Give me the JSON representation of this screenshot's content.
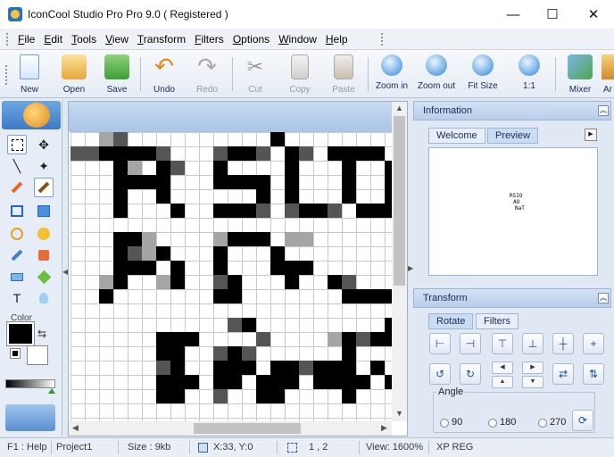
{
  "window": {
    "title": "IconCool Studio Pro Pro 9.0 ( Registered )",
    "minimize_glyph": "—",
    "maximize_glyph": "☐",
    "close_glyph": "✕"
  },
  "menu": [
    "File",
    "Edit",
    "Tools",
    "View",
    "Transform",
    "Filters",
    "Options",
    "Window",
    "Help"
  ],
  "toolbar": [
    {
      "label": "New",
      "icon": "new-file-icon",
      "enabled": true
    },
    {
      "label": "Open",
      "icon": "open-folder-icon",
      "enabled": true
    },
    {
      "label": "Save",
      "icon": "save-disk-icon",
      "enabled": true
    },
    {
      "label": "Undo",
      "icon": "undo-arrow-icon",
      "enabled": true
    },
    {
      "label": "Redo",
      "icon": "redo-arrow-icon",
      "enabled": false
    },
    {
      "label": "Cut",
      "icon": "scissors-icon",
      "enabled": false
    },
    {
      "label": "Copy",
      "icon": "copy-icon",
      "enabled": false
    },
    {
      "label": "Paste",
      "icon": "paste-icon",
      "enabled": false
    },
    {
      "label": "Zoom in",
      "icon": "zoom-in-icon",
      "enabled": true
    },
    {
      "label": "Zoom out",
      "icon": "zoom-out-icon",
      "enabled": true
    },
    {
      "label": "Fit Size",
      "icon": "fit-size-icon",
      "enabled": true
    },
    {
      "label": "1:1",
      "icon": "actual-size-icon",
      "enabled": true
    },
    {
      "label": "Mixer",
      "icon": "mixer-icon",
      "enabled": true
    },
    {
      "label": "Ar",
      "icon": "arrange-icon",
      "enabled": true
    }
  ],
  "tools": {
    "color_label": "Color",
    "swap_glyph": "⇆",
    "items": [
      "marquee-select-icon",
      "move-arrow-icon",
      "line-icon",
      "magic-wand-icon",
      "pencil-icon",
      "brush-icon",
      "rectangle-outline-icon",
      "rectangle-fill-icon",
      "ellipse-outline-icon",
      "ellipse-fill-icon",
      "eyedropper-icon",
      "fill-bucket-icon",
      "eraser-icon",
      "diamond-gem-icon",
      "text-tool-icon",
      "lightbulb-icon"
    ],
    "foreground_color": "#000000",
    "background_color": "#ffffff"
  },
  "info_panel": {
    "title": "Information",
    "tabs": [
      "Welcome",
      "Preview"
    ],
    "active_tab": "Preview",
    "preview_lines": [
      "RSIO",
      "AO",
      "NaT"
    ]
  },
  "transform_panel": {
    "title": "Transform",
    "tabs": [
      "Rotate",
      "Filters"
    ],
    "active_tab": "Rotate",
    "angle_label": "Angle",
    "angles": [
      "90",
      "180",
      "270"
    ]
  },
  "status": {
    "help": "F1 : Help",
    "project": "Project1",
    "size": "Size : 9kb",
    "cursor": "X:33, Y:0",
    "selection": "1 , 2",
    "view": "View: 1600%",
    "mode": "XP REG"
  }
}
